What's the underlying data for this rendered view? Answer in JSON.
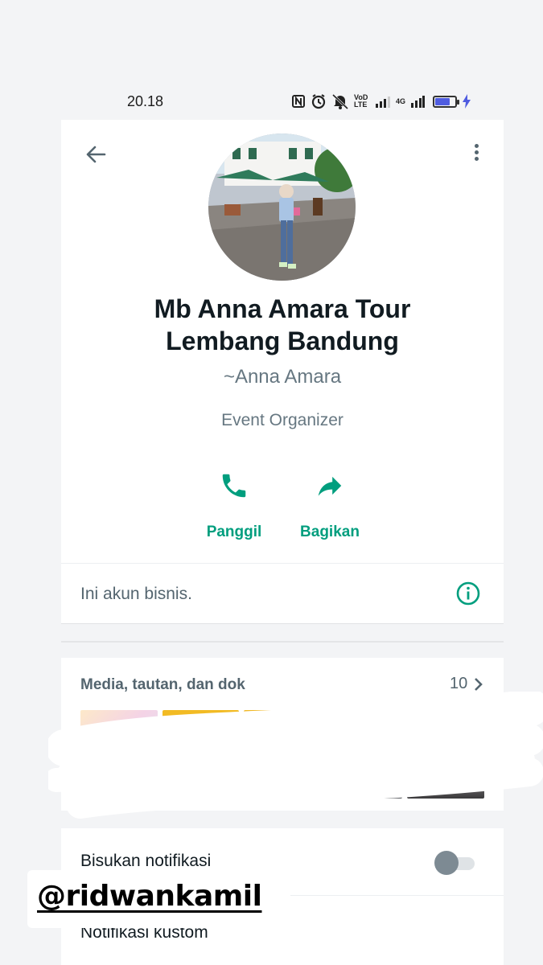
{
  "status_bar": {
    "time": "20.18",
    "volte_label": "VoD LTE",
    "network_label": "4G",
    "battery_level": 0.6,
    "battery_color": "#4f5ce0",
    "icons": [
      "nfc-icon",
      "alarm-icon",
      "mute-icon",
      "volte-icon",
      "signal-icon",
      "4g-signal-icon",
      "battery-icon",
      "charging-icon"
    ]
  },
  "header": {
    "back_icon": "arrow-left-icon",
    "menu_icon": "more-vertical-icon"
  },
  "profile": {
    "name_line1": "Mb Anna Amara Tour",
    "name_line2": "Lembang Bandung",
    "push_name": "~Anna Amara",
    "category": "Event Organizer",
    "actions": [
      {
        "label": "Panggil",
        "icon": "phone-icon"
      },
      {
        "label": "Bagikan",
        "icon": "share-arrow-icon"
      }
    ],
    "business_note": "Ini akun bisnis.",
    "accent_color": "#009e7e"
  },
  "media": {
    "title": "Media, tautan, dan dok",
    "count": "10"
  },
  "settings": {
    "mute_label": "Bisukan notifikasi",
    "mute_enabled": false,
    "custom_label": "Notifikasi kustom"
  },
  "overlay": {
    "mention": "@ridwankamil"
  }
}
